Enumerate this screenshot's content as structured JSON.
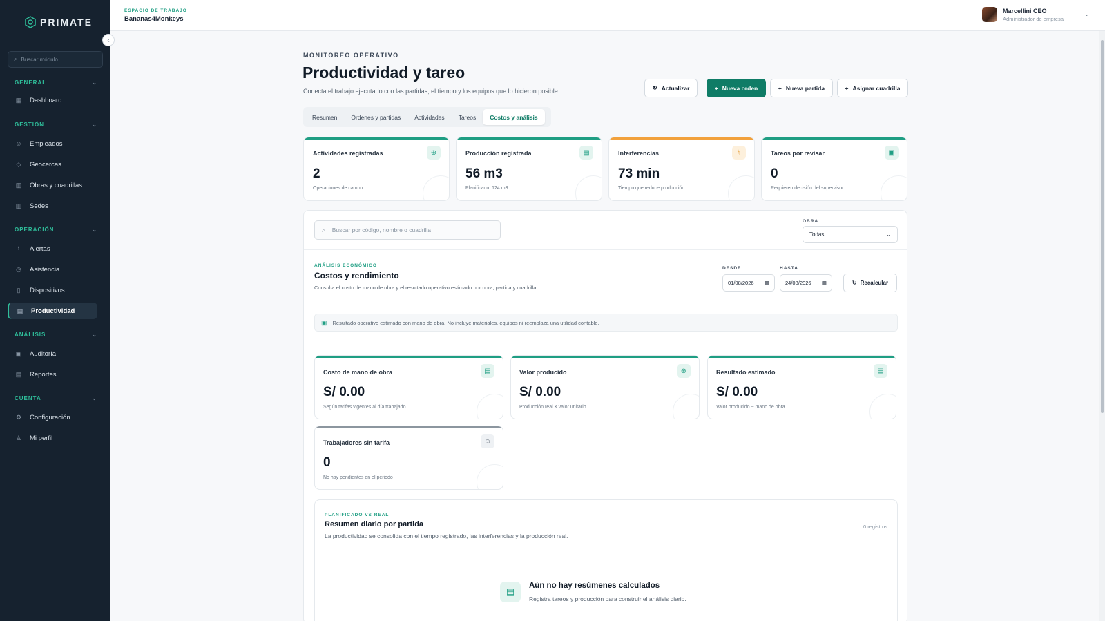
{
  "app": {
    "logo_text": "PRIMATE"
  },
  "sidebar": {
    "search_placeholder": "Buscar módulo...",
    "sections": [
      {
        "label": "GENERAL",
        "items": [
          {
            "label": "Dashboard",
            "icon": "grid-icon"
          }
        ]
      },
      {
        "label": "GESTIÓN",
        "items": [
          {
            "label": "Empleados",
            "icon": "users-icon"
          },
          {
            "label": "Geocercas",
            "icon": "shield-icon"
          },
          {
            "label": "Obras y cuadrillas",
            "icon": "building-icon"
          },
          {
            "label": "Sedes",
            "icon": "building-icon"
          }
        ]
      },
      {
        "label": "OPERACIÓN",
        "items": [
          {
            "label": "Alertas",
            "icon": "bell-icon"
          },
          {
            "label": "Asistencia",
            "icon": "clock-icon"
          },
          {
            "label": "Dispositivos",
            "icon": "phone-icon"
          },
          {
            "label": "Productividad",
            "icon": "chart-icon",
            "active": true
          }
        ]
      },
      {
        "label": "ANÁLISIS",
        "items": [
          {
            "label": "Auditoría",
            "icon": "clipboard-icon"
          },
          {
            "label": "Reportes",
            "icon": "file-icon"
          }
        ]
      },
      {
        "label": "CUENTA",
        "items": [
          {
            "label": "Configuración",
            "icon": "gear-icon"
          },
          {
            "label": "Mi perfil",
            "icon": "user-icon"
          }
        ]
      }
    ]
  },
  "topbar": {
    "workspace_label": "ESPACIO DE TRABAJO",
    "workspace_name": "Bananas4Monkeys",
    "user_name": "Marcellini CEO",
    "user_role": "Administrador de empresa"
  },
  "header": {
    "eyebrow": "MONITOREO OPERATIVO",
    "title": "Productividad y tareo",
    "subtitle": "Conecta el trabajo ejecutado con las partidas, el tiempo y los equipos que lo hicieron posible.",
    "buttons": {
      "refresh": "Actualizar",
      "new_order": "Nueva orden",
      "new_item": "Nueva partida",
      "assign_crew": "Asignar cuadrilla"
    }
  },
  "tabs": [
    "Resumen",
    "Órdenes y partidas",
    "Actividades",
    "Tareos",
    "Costos y análisis"
  ],
  "active_tab_index": 4,
  "kpis": [
    {
      "title": "Actividades registradas",
      "value": "2",
      "note": "Operaciones de campo",
      "icon": "activity-icon",
      "accent": "#1f9e83"
    },
    {
      "title": "Producción registrada",
      "value": "56 m3",
      "note": "Planificado: 124 m3",
      "icon": "chart-icon",
      "accent": "#1f9e83"
    },
    {
      "title": "Interferencias",
      "value": "73 min",
      "note": "Tiempo que reduce producción",
      "icon": "bell-icon",
      "accent": "#f2a13c"
    },
    {
      "title": "Tareos por revisar",
      "value": "0",
      "note": "Requieren decisión del supervisor",
      "icon": "clipboard-icon",
      "accent": "#1f9e83"
    }
  ],
  "filters": {
    "search_placeholder": "Buscar por código, nombre o cuadrilla",
    "obra_label": "OBRA",
    "obra_value": "Todas"
  },
  "costs": {
    "eyebrow": "ANÁLISIS ECONÓMICO",
    "title": "Costos y rendimiento",
    "subtitle": "Consulta el costo de mano de obra y el resultado operativo estimado por obra, partida y cuadrilla.",
    "from_label": "DESDE",
    "from_value": "01/08/2026",
    "to_label": "HASTA",
    "to_value": "24/08/2026",
    "recalc_label": "Recalcular",
    "notice": "Resultado operativo estimado con mano de obra. No incluye materiales, equipos ni reemplaza una utilidad contable.",
    "cards": [
      {
        "title": "Costo de mano de obra",
        "value": "S/ 0.00",
        "note": "Según tarifas vigentes al día trabajado",
        "icon": "chart-icon"
      },
      {
        "title": "Valor producido",
        "value": "S/ 0.00",
        "note": "Producción real × valor unitario",
        "icon": "activity-icon"
      },
      {
        "title": "Resultado estimado",
        "value": "S/ 0.00",
        "note": "Valor producido − mano de obra",
        "icon": "chart-icon"
      },
      {
        "title": "Trabajadores sin tarifa",
        "value": "0",
        "note": "No hay pendientes en el periodo",
        "icon": "users-icon"
      }
    ]
  },
  "daily": {
    "eyebrow": "PLANIFICADO VS REAL",
    "title": "Resumen diario por partida",
    "subtitle": "La productividad se consolida con el tiempo registrado, las interferencias y la producción real.",
    "count": "0 registros",
    "empty_title": "Aún no hay resúmenes calculados",
    "empty_sub": "Registra tareos y producción para construir el análisis diario."
  }
}
